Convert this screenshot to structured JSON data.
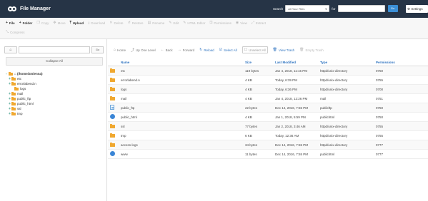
{
  "app": {
    "title": "File Manager"
  },
  "search": {
    "label": "Search",
    "scope": "All Your Files",
    "for_label": "for",
    "input_value": "",
    "go_label": "Go",
    "settings_label": "Settings"
  },
  "toolbar": {
    "row1": [
      {
        "icon": "plus-icon",
        "glyph": "+",
        "label": "File",
        "enabled": true
      },
      {
        "icon": "plus-icon",
        "glyph": "+",
        "label": "Folder",
        "enabled": true
      },
      {
        "icon": "copy-icon",
        "glyph": "❐",
        "label": "Copy",
        "enabled": false
      },
      {
        "icon": "move-icon",
        "glyph": "✥",
        "label": "Move",
        "enabled": false
      },
      {
        "icon": "upload-icon",
        "glyph": "⤒",
        "label": "Upload",
        "enabled": true
      },
      {
        "icon": "download-icon",
        "glyph": "⤓",
        "label": "Download",
        "enabled": false
      },
      {
        "icon": "delete-icon",
        "glyph": "✕",
        "label": "Delete",
        "enabled": false
      },
      {
        "icon": "restore-icon",
        "glyph": "↺",
        "label": "Restore",
        "enabled": false
      },
      {
        "icon": "rename-icon",
        "glyph": "▤",
        "label": "Rename",
        "enabled": false
      },
      {
        "icon": "edit-icon",
        "glyph": "✎",
        "label": "Edit",
        "enabled": false
      },
      {
        "icon": "html-editor-icon",
        "glyph": "✎",
        "label": "HTML Editor",
        "enabled": false
      },
      {
        "icon": "permissions-icon",
        "glyph": "⚿",
        "label": "Permissions",
        "enabled": false
      },
      {
        "icon": "view-icon",
        "glyph": "◉",
        "label": "View",
        "enabled": false
      },
      {
        "icon": "extract-icon",
        "glyph": "⤢",
        "label": "Extract",
        "enabled": false
      }
    ],
    "row2": [
      {
        "icon": "compress-icon",
        "glyph": "⤡",
        "label": "Compress",
        "enabled": false
      }
    ]
  },
  "sidebar": {
    "home_glyph": "⌂",
    "path_value": "",
    "go_label": "Go",
    "collapse_label": "Collapse All",
    "tree": [
      {
        "prefix": "-",
        "label": "(/home/zmienna)",
        "indent": 0,
        "bold": true,
        "home": true
      },
      {
        "prefix": "+",
        "label": "etc",
        "indent": 1,
        "bold": false,
        "home": false
      },
      {
        "prefix": "+",
        "label": "errorlabend.n",
        "indent": 1,
        "bold": false,
        "home": false
      },
      {
        "prefix": "",
        "label": "logs",
        "indent": 2,
        "bold": false,
        "home": false
      },
      {
        "prefix": "+",
        "label": "mail",
        "indent": 1,
        "bold": false,
        "home": false
      },
      {
        "prefix": "+",
        "label": "public_ftp",
        "indent": 1,
        "bold": false,
        "home": false
      },
      {
        "prefix": "+",
        "label": "public_html",
        "indent": 1,
        "bold": false,
        "home": false
      },
      {
        "prefix": "+",
        "label": "ssl",
        "indent": 1,
        "bold": false,
        "home": false
      },
      {
        "prefix": "+",
        "label": "tmp",
        "indent": 1,
        "bold": false,
        "home": false
      }
    ]
  },
  "subtoolbar": [
    {
      "icon": "home-icon",
      "glyph": "⌂",
      "label": "Home",
      "style": "normal"
    },
    {
      "icon": "up-level-icon",
      "glyph": "⤴",
      "label": "Up One Level",
      "style": "normal"
    },
    {
      "icon": "back-icon",
      "glyph": "←",
      "label": "Back",
      "style": "normal"
    },
    {
      "icon": "forward-icon",
      "glyph": "→",
      "label": "Forward",
      "style": "normal"
    },
    {
      "icon": "reload-icon",
      "glyph": "↻",
      "label": "Reload",
      "style": "blue"
    },
    {
      "icon": "select-all-icon",
      "glyph": "☑",
      "label": "Select All",
      "style": "blue"
    },
    {
      "icon": "unselect-all-icon",
      "glyph": "☐",
      "label": "Unselect All",
      "style": "boxed"
    },
    {
      "icon": "trash-icon",
      "glyph": "🗑",
      "label": "View Trash",
      "style": "blue"
    },
    {
      "icon": "empty-trash-icon",
      "glyph": "🗑",
      "label": "Empty Trash",
      "style": "disabled"
    }
  ],
  "table": {
    "columns": [
      "Name",
      "Size",
      "Last Modified",
      "Type",
      "Permissions"
    ],
    "rows": [
      {
        "icon": "folder",
        "name": "etc",
        "size": "119 bytes",
        "modified": "Jan 4, 2018, 11:15 PM",
        "type": "httpd/unix-directory",
        "perm": "0750"
      },
      {
        "icon": "folder",
        "name": "errorlabend.n",
        "size": "4 KB",
        "modified": "Today, 6:39 PM",
        "type": "httpd/unix-directory",
        "perm": "0755"
      },
      {
        "icon": "folder",
        "name": "logs",
        "size": "4 KB",
        "modified": "Today, 6:36 PM",
        "type": "httpd/unix-directory",
        "perm": "0700"
      },
      {
        "icon": "folder",
        "name": "mail",
        "size": "4 KB",
        "modified": "Jan 4, 2018, 12:26 PM",
        "type": "mail",
        "perm": "0751"
      },
      {
        "icon": "doc",
        "name": "public_ftp",
        "size": "22 bytes",
        "modified": "Dec 14, 2016, 7:55 PM",
        "type": "publicftp",
        "perm": "0750"
      },
      {
        "icon": "globe",
        "name": "public_html",
        "size": "4 KB",
        "modified": "Jan 1, 2018, 5:59 PM",
        "type": "publichtml",
        "perm": "0750"
      },
      {
        "icon": "folder",
        "name": "ssl",
        "size": "77 bytes",
        "modified": "Jan 2, 2018, 3:46 AM",
        "type": "httpd/unix-directory",
        "perm": "0755"
      },
      {
        "icon": "folder",
        "name": "tmp",
        "size": "6 KB",
        "modified": "Today, 12:36 AM",
        "type": "httpd/unix-directory",
        "perm": "0755"
      },
      {
        "icon": "folder",
        "name": "access-logs",
        "size": "34 bytes",
        "modified": "Dec 14, 2016, 7:55 PM",
        "type": "httpd/unix-directory",
        "perm": "0777"
      },
      {
        "icon": "globe",
        "name": "www",
        "size": "11 bytes",
        "modified": "Dec 14, 2016, 7:55 PM",
        "type": "publichtml",
        "perm": "0777"
      }
    ]
  },
  "colors": {
    "topbar": "#263446",
    "accent": "#2f74c0",
    "go_button": "#3b8fd6",
    "folder": "#f0a830"
  }
}
